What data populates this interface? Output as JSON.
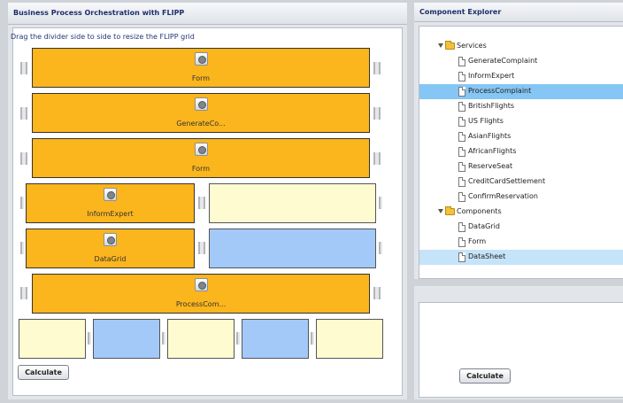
{
  "left_panel": {
    "title": "Business Process Orchestration with FLIPP",
    "instructions": "Drag the divider side to side to resize the FLIPP grid",
    "blocks": {
      "form_1": "Form",
      "generate": "GenerateCo...",
      "form_2": "Form",
      "inform": "InformExpert",
      "datagrid": "DataGrid",
      "process": "ProcessCom..."
    },
    "calculate_label": "Calculate"
  },
  "explorer": {
    "title": "Component Explorer",
    "services_label": "Services",
    "services": [
      "GenerateComplaint",
      "InformExpert",
      "ProcessComplaint",
      "BritishFlights",
      "US Flights",
      "AsianFlights",
      "AfricanFlights",
      "ReserveSeat",
      "CreditCardSettlement",
      "ConfirmReservation"
    ],
    "components_label": "Components",
    "components": [
      "DataGrid",
      "Form",
      "DataSheet"
    ],
    "selected_item": "ProcessComplaint"
  },
  "right_bottom": {
    "calculate_label": "Calculate"
  },
  "colors": {
    "orange": "#fbb51d",
    "yellow": "#fffbd0",
    "blue": "#a3c9f8",
    "selection": "#86c6f4"
  }
}
